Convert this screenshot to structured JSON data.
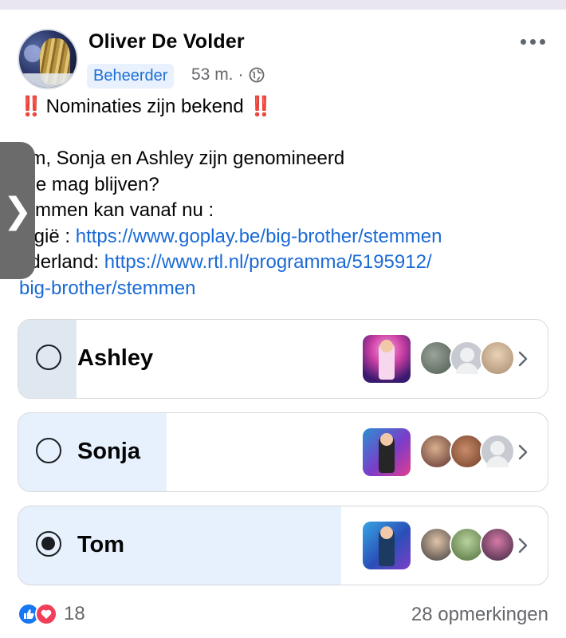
{
  "post": {
    "author": "Oliver De Volder",
    "badge": "Beheerder",
    "time": "53 m.",
    "separator": "·",
    "privacy_icon": "globe-icon",
    "more_icon": "more-icon",
    "title": "Nominaties zijn bekend",
    "title_emoji": "‼️",
    "lines": {
      "l1": "om, Sonja en Ashley zijn genomineerd",
      "l2": "Vie mag blijven?",
      "l3": "temmen kan vanaf nu :",
      "l4_text": "elgië : ",
      "l4_link": "https://www.goplay.be/big-brother/stemmen",
      "l5_text": "ederland: ",
      "l5_link": "https://www.rtl.nl/programma/5195912/",
      "l6_link": "big-brother/stemmen"
    }
  },
  "side_tab": {
    "glyph": "❯"
  },
  "poll": {
    "options": [
      {
        "label": "Ashley",
        "selected": false,
        "share": 0.11
      },
      {
        "label": "Sonja",
        "selected": false,
        "share": 0.28
      },
      {
        "label": "Tom",
        "selected": true,
        "share": 0.61
      }
    ]
  },
  "footer": {
    "reaction_icons": [
      "like-icon",
      "love-icon"
    ],
    "reaction_count": "18",
    "comments": "28 opmerkingen"
  },
  "colors": {
    "link": "#1a6ad6",
    "badge_bg": "#e8f1fd",
    "poll_fill": "#e7f0fd",
    "like": "#1877f2",
    "love": "#f33e58"
  }
}
